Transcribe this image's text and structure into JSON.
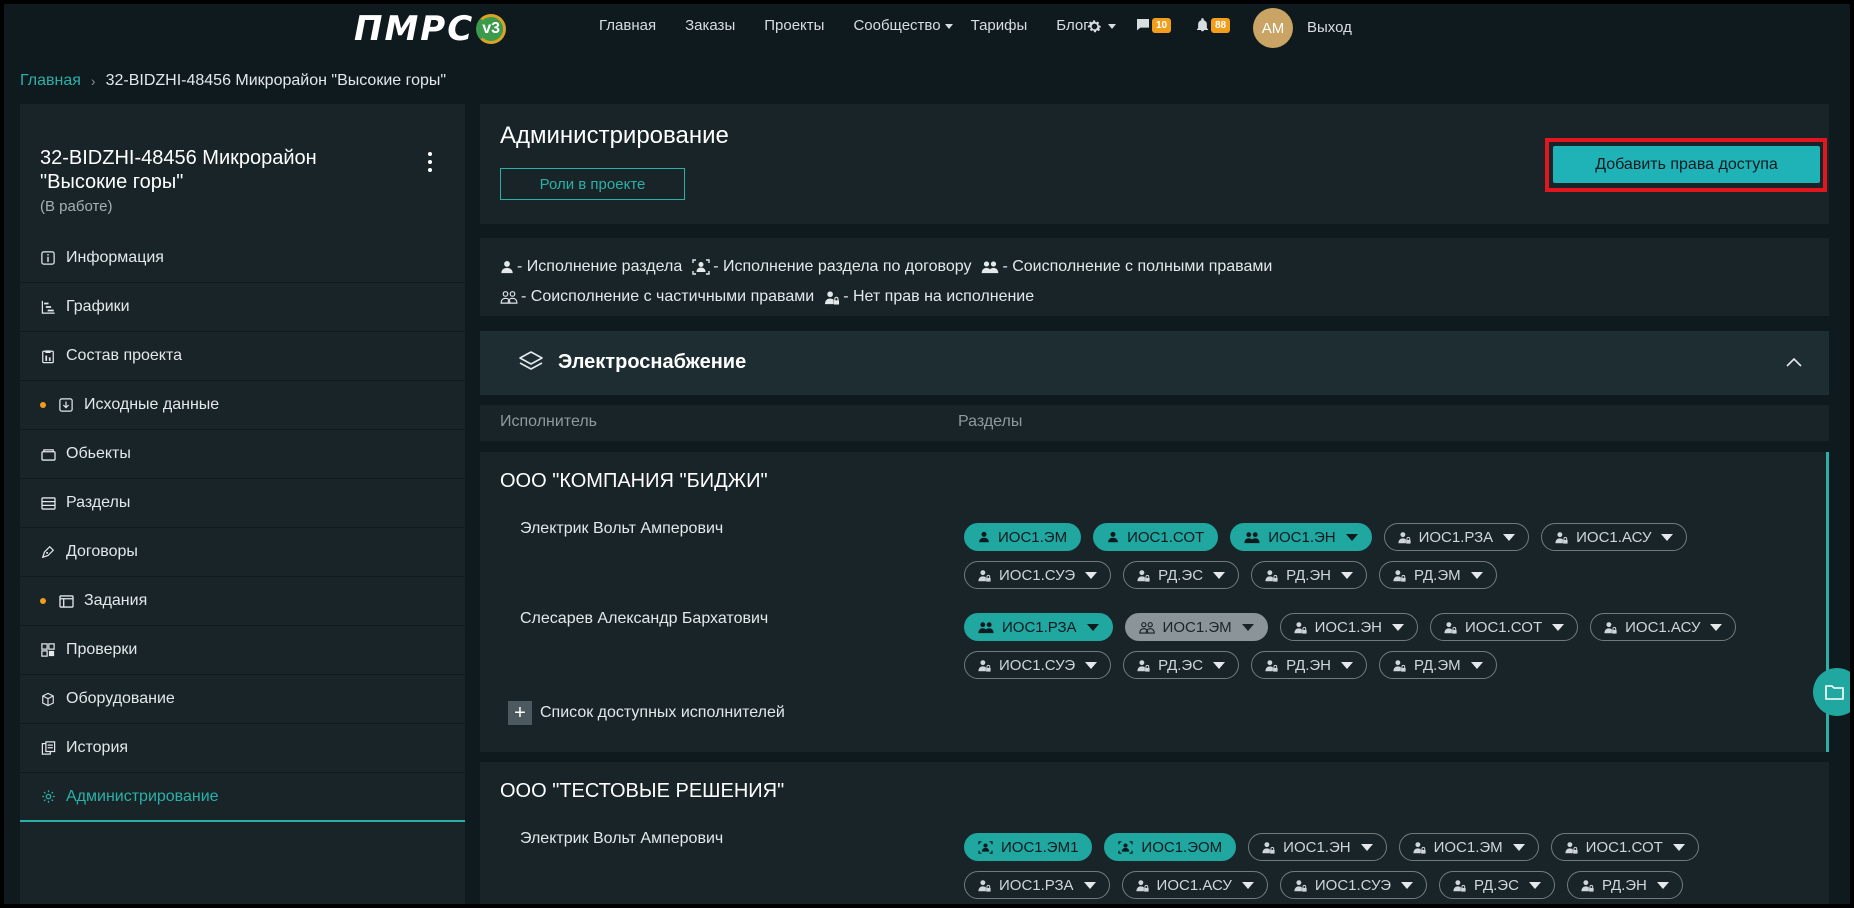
{
  "header": {
    "logo_text": "ПМРС",
    "logo_badge": "v3",
    "nav": [
      {
        "label": "Главная"
      },
      {
        "label": "Заказы"
      },
      {
        "label": "Проекты"
      },
      {
        "label": "Сообщество"
      },
      {
        "label": "Тарифы"
      },
      {
        "label": "Блог"
      }
    ],
    "messages_count": "10",
    "notifications_count": "88",
    "avatar_initials": "АМ",
    "logout": "Выход"
  },
  "breadcrumb": {
    "home": "Главная",
    "separator": "›",
    "current": "32-BIDZHI-48456 Микрорайон \"Высокие горы\""
  },
  "sidebar": {
    "project_title": "32-BIDZHI-48456 Микрорайон \"Высокие горы\"",
    "project_status": "(В работе)",
    "items": [
      {
        "label": "Информация",
        "icon": "info-icon",
        "dot": false
      },
      {
        "label": "Графики",
        "icon": "gantt-icon",
        "dot": false
      },
      {
        "label": "Состав проекта",
        "icon": "clipboard-icon",
        "dot": false
      },
      {
        "label": "Исходные данные",
        "icon": "download-icon",
        "dot": true
      },
      {
        "label": "Обьекты",
        "icon": "box-icon",
        "dot": false
      },
      {
        "label": "Разделы",
        "icon": "layers-icon",
        "dot": false
      },
      {
        "label": "Договоры",
        "icon": "pen-icon",
        "dot": false
      },
      {
        "label": "Задания",
        "icon": "tasks-icon",
        "dot": true
      },
      {
        "label": "Проверки",
        "icon": "grid-icon",
        "dot": false
      },
      {
        "label": "Оборудование",
        "icon": "cube-icon",
        "dot": false
      },
      {
        "label": "История",
        "icon": "history-icon",
        "dot": false
      },
      {
        "label": "Администрирование",
        "icon": "gear-icon",
        "dot": false,
        "active": true
      }
    ]
  },
  "admin": {
    "title": "Администрирование",
    "roles_button": "Роли в проекте",
    "add_access_button": "Добавить права доступа"
  },
  "legend": {
    "items": [
      "- Исполнение раздела",
      "- Исполнение раздела по договору",
      "- Соисполнение с полными правами",
      "- Соисполнение с частичными правами",
      "- Нет прав на исполнение"
    ]
  },
  "section": {
    "title": "Электроснабжение",
    "col_executor": "Исполнитель",
    "col_sections": "Разделы"
  },
  "orgs": [
    {
      "name": "ООО \"КОМПАНИЯ \"БИДЖИ\"",
      "people": [
        {
          "name": "Электрик Вольт Амперович",
          "chips": [
            {
              "label": "ИОС1.ЭМ",
              "state": "on",
              "kind": "single",
              "caret": false
            },
            {
              "label": "ИОС1.СОТ",
              "state": "on",
              "kind": "single",
              "caret": false
            },
            {
              "label": "ИОС1.ЭН",
              "state": "on",
              "kind": "full",
              "caret": true
            },
            {
              "label": "ИОС1.РЗА",
              "state": "off",
              "kind": "none",
              "caret": true
            },
            {
              "label": "ИОС1.АСУ",
              "state": "off",
              "kind": "none",
              "caret": true
            },
            {
              "label": "ИОС1.СУЭ",
              "state": "off",
              "kind": "none",
              "caret": true
            },
            {
              "label": "РД.ЭС",
              "state": "off",
              "kind": "none",
              "caret": true
            },
            {
              "label": "РД.ЭН",
              "state": "off",
              "kind": "none",
              "caret": true
            },
            {
              "label": "РД.ЭМ",
              "state": "off",
              "kind": "none",
              "caret": true
            }
          ]
        },
        {
          "name": "Слесарев Александр Бархатович",
          "chips": [
            {
              "label": "ИОС1.РЗА",
              "state": "on",
              "kind": "full",
              "caret": true
            },
            {
              "label": "ИОС1.ЭМ",
              "state": "partial",
              "kind": "partial",
              "caret": true
            },
            {
              "label": "ИОС1.ЭН",
              "state": "off",
              "kind": "none",
              "caret": true
            },
            {
              "label": "ИОС1.СОТ",
              "state": "off",
              "kind": "none",
              "caret": true
            },
            {
              "label": "ИОС1.АСУ",
              "state": "off",
              "kind": "none",
              "caret": true
            },
            {
              "label": "ИОС1.СУЭ",
              "state": "off",
              "kind": "none",
              "caret": true
            },
            {
              "label": "РД.ЭС",
              "state": "off",
              "kind": "none",
              "caret": true
            },
            {
              "label": "РД.ЭН",
              "state": "off",
              "kind": "none",
              "caret": true
            },
            {
              "label": "РД.ЭМ",
              "state": "off",
              "kind": "none",
              "caret": true
            }
          ]
        }
      ],
      "add_executor": "Список доступных исполнителей"
    },
    {
      "name": "ООО \"ТЕСТОВЫЕ РЕШЕНИЯ\"",
      "people": [
        {
          "name": "Электрик Вольт Амперович",
          "chips": [
            {
              "label": "ИОС1.ЭМ1",
              "state": "on",
              "kind": "contract",
              "caret": false
            },
            {
              "label": "ИОС1.ЭОМ",
              "state": "on",
              "kind": "contract",
              "caret": false
            },
            {
              "label": "ИОС1.ЭН",
              "state": "off",
              "kind": "none",
              "caret": true
            },
            {
              "label": "ИОС1.ЭМ",
              "state": "off",
              "kind": "none",
              "caret": true
            },
            {
              "label": "ИОС1.СОТ",
              "state": "off",
              "kind": "none",
              "caret": true
            },
            {
              "label": "ИОС1.РЗА",
              "state": "off",
              "kind": "none",
              "caret": true
            },
            {
              "label": "ИОС1.АСУ",
              "state": "off",
              "kind": "none",
              "caret": true
            },
            {
              "label": "ИОС1.СУЭ",
              "state": "off",
              "kind": "none",
              "caret": true
            },
            {
              "label": "РД.ЭС",
              "state": "off",
              "kind": "none",
              "caret": true
            },
            {
              "label": "РД.ЭН",
              "state": "off",
              "kind": "none",
              "caret": true
            }
          ]
        }
      ]
    }
  ],
  "colors": {
    "accent": "#1fa7a0",
    "background": "#0f1a1f",
    "panel": "#182428",
    "badge": "#f29e1b",
    "highlight": "#e2161e"
  }
}
